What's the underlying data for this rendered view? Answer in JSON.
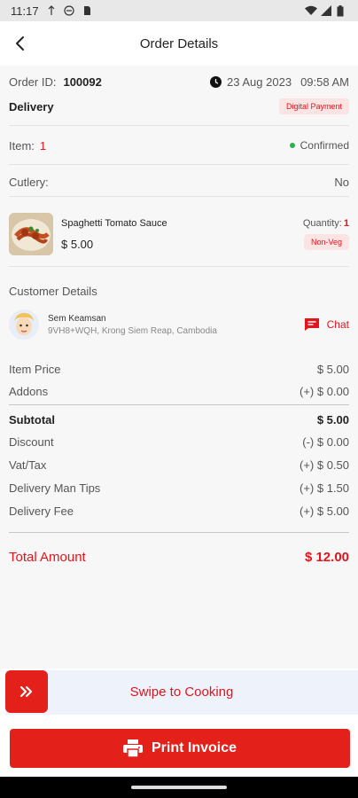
{
  "status_bar": {
    "time": "11:17"
  },
  "header": {
    "title": "Order Details"
  },
  "order": {
    "id_label": "Order ID:",
    "id_value": "100092",
    "date": "23 Aug 2023",
    "time": "09:58 AM",
    "type": "Delivery",
    "payment_badge": "Digital Payment",
    "item_label": "Item:",
    "item_count": "1",
    "status": "Confirmed",
    "cutlery_label": "Cutlery:",
    "cutlery_value": "No"
  },
  "food": {
    "name": "Spaghetti Tomato Sauce",
    "price": "$ 5.00",
    "quantity_label": "Quantity:",
    "quantity_value": "1",
    "tag": "Non-Veg"
  },
  "customer": {
    "section_title": "Customer Details",
    "name": "Sem Keamsan",
    "address": "9VH8+WQH, Krong Siem Reap, Cambodia",
    "chat_label": "Chat"
  },
  "summary": {
    "item_price_label": "Item Price",
    "item_price_value": "$ 5.00",
    "addons_label": "Addons",
    "addons_value": "(+) $ 0.00",
    "subtotal_label": "Subtotal",
    "subtotal_value": "$ 5.00",
    "discount_label": "Discount",
    "discount_value": "(-) $ 0.00",
    "vat_label": "Vat/Tax",
    "vat_value": "(+) $ 0.50",
    "tips_label": "Delivery Man Tips",
    "tips_value": "(+) $ 1.50",
    "fee_label": "Delivery Fee",
    "fee_value": "(+) $ 5.00",
    "total_label": "Total Amount",
    "total_value": "$ 12.00"
  },
  "actions": {
    "swipe_label": "Swipe to Cooking",
    "print_label": "Print Invoice"
  },
  "icons": {
    "back": "arrow-left-icon",
    "clock": "clock-icon",
    "chat": "chat-icon",
    "swipe": "double-chevron-right-icon",
    "print": "printer-icon"
  },
  "colors": {
    "accent": "#e32019",
    "status_green": "#2bb24c"
  }
}
